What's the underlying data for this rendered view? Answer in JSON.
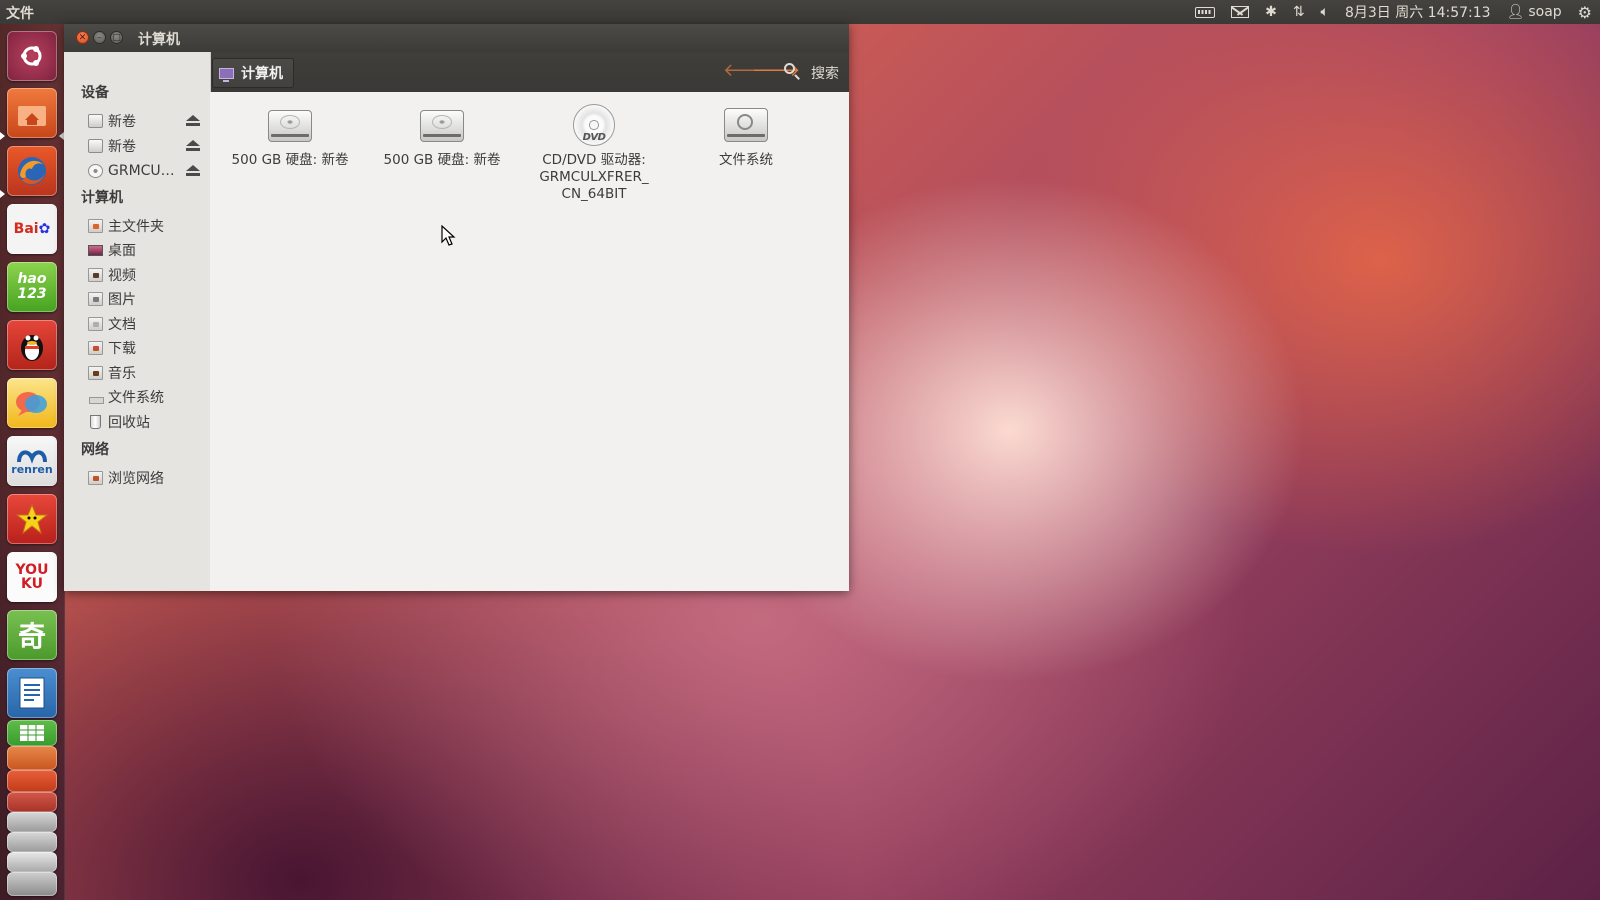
{
  "top_panel": {
    "app_menu": "文件",
    "datetime": "8月3日 周六 14:57:13",
    "user": "soap"
  },
  "launcher": {
    "items": [
      {
        "name": "dash-home",
        "label": "",
        "bg": "#9b3450"
      },
      {
        "name": "home-folder",
        "label": "",
        "bg": "#dd5a1f"
      },
      {
        "name": "firefox",
        "label": "",
        "bg": "#2b5aa8"
      },
      {
        "name": "baidu",
        "label": "Bai",
        "bg": "#f4f4f4"
      },
      {
        "name": "hao123",
        "label": "hao 123",
        "bg": "#5cb82e"
      },
      {
        "name": "qq",
        "label": "",
        "bg": "#d93a2b"
      },
      {
        "name": "chat-bubble",
        "label": "",
        "bg": "#f5c422"
      },
      {
        "name": "renren",
        "label": "renren",
        "bg": "#1d5ca8"
      },
      {
        "name": "kaixin",
        "label": "",
        "bg": "#d22a2a"
      },
      {
        "name": "youku",
        "label": "YOU KU",
        "bg": "#fbfbfb"
      },
      {
        "name": "qiyi",
        "label": "奇",
        "bg": "#5da43b"
      },
      {
        "name": "writer",
        "label": "",
        "bg": "#3474b5"
      },
      {
        "name": "calc",
        "label": "",
        "bg": "#3fa33a"
      }
    ]
  },
  "window": {
    "title": "计算机",
    "location": "计算机",
    "search_label": "搜索"
  },
  "sidebar": {
    "sections": [
      {
        "heading": "设备",
        "items": [
          "新卷",
          "新卷",
          "GRMCU…"
        ]
      },
      {
        "heading": "计算机",
        "items": [
          "主文件夹",
          "桌面",
          "视频",
          "图片",
          "文档",
          "下载",
          "音乐",
          "文件系统",
          "回收站"
        ]
      },
      {
        "heading": "网络",
        "items": [
          "浏览网络"
        ]
      }
    ]
  },
  "files": [
    {
      "type": "hdd",
      "label": "500 GB 硬盘: 新卷"
    },
    {
      "type": "hdd",
      "label": "500 GB 硬盘: 新卷"
    },
    {
      "type": "dvd",
      "label": "CD/DVD 驱动器: GRMCULXFRER_ CN_64BIT",
      "icon_text": "DVD"
    },
    {
      "type": "filesystem",
      "label": "文件系统"
    }
  ]
}
